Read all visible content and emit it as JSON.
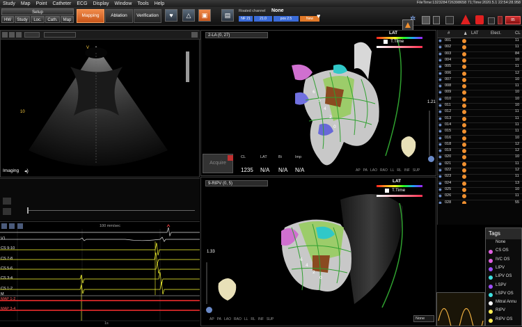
{
  "menu": [
    "Study",
    "Map",
    "Point",
    "Catheter",
    "ECG",
    "Display",
    "Window",
    "Tools",
    "Help"
  ],
  "file_info": "FileTime:1323284726398658 71;Time:2020.5.1 22:54:28.958",
  "toolbar": {
    "setup_label": "Setup",
    "setup_tabs": [
      "HW",
      "Study",
      "Loc.",
      "Cath.",
      "Map"
    ],
    "mapping_label": "Mapping",
    "ablation_label": "Ablation",
    "verification_label": "Verification",
    "roated_channel_label": "Roated channel",
    "roated_channel_value": "None",
    "channel_chips": [
      "NF 21",
      "21.0",
      "pos 2.5",
      "New"
    ]
  },
  "ultrasound": {
    "marker_v": "V",
    "depth_10": "10",
    "imaging_label": "Imaging"
  },
  "ecg": {
    "speed_label": "100 mm/sec",
    "channels": [
      {
        "name": "",
        "color": "#ffffff"
      },
      {
        "name": "V1",
        "color": "#ffffff"
      },
      {
        "name": "CS 9-10",
        "color": "#ffff33"
      },
      {
        "name": "CS 7-8",
        "color": "#ffff33"
      },
      {
        "name": "CS 5-6",
        "color": "#ffff33"
      },
      {
        "name": "CS 3-4",
        "color": "#ffff33"
      },
      {
        "name": "CS 1-2",
        "color": "#ffff33"
      },
      {
        "name": "M",
        "color": "#ffffff"
      },
      {
        "name": "MAP 1-2",
        "color": "#ff3030"
      },
      {
        "name": "MAP 3-4",
        "color": "#ff3030"
      }
    ],
    "time_tick": "1s"
  },
  "map_top": {
    "title": "2-LA (0, 27)",
    "legend_lat": "LAT",
    "legend_ttime": "T.Time",
    "zoom": "1.21",
    "acquire_label": "Acquire",
    "readout_headers": [
      "CL",
      "LAT",
      "Bi",
      "Imp"
    ],
    "readout_values": [
      "1235",
      "N/A",
      "N/A",
      "N/A"
    ],
    "view_buttons": [
      "AP",
      "PA",
      "LAO",
      "RAO",
      "LL",
      "RL",
      "INF",
      "SUP"
    ]
  },
  "map_bottom": {
    "title": "9-RIPV (0, 5)",
    "legend_lat": "LAT",
    "legend_ttime": "T.Time",
    "zoom": "1.33",
    "view_buttons": [
      "AP",
      "PA",
      "LAO",
      "RAO",
      "LL",
      "RL",
      "INF",
      "SUP"
    ],
    "none_select": "None"
  },
  "points_table": {
    "headers": [
      "#",
      "LAT",
      "Elect.",
      "CL"
    ],
    "rows": [
      {
        "id": "001",
        "cl": "11"
      },
      {
        "id": "002",
        "cl": "11"
      },
      {
        "id": "003",
        "cl": "84"
      },
      {
        "id": "004",
        "cl": "10"
      },
      {
        "id": "005",
        "cl": "11"
      },
      {
        "id": "006",
        "cl": "12"
      },
      {
        "id": "007",
        "cl": "10"
      },
      {
        "id": "008",
        "cl": "11"
      },
      {
        "id": "009",
        "cl": "10"
      },
      {
        "id": "010",
        "cl": "10"
      },
      {
        "id": "011",
        "cl": "10"
      },
      {
        "id": "012",
        "cl": "11"
      },
      {
        "id": "013",
        "cl": "11"
      },
      {
        "id": "014",
        "cl": "11"
      },
      {
        "id": "015",
        "cl": "11"
      },
      {
        "id": "016",
        "cl": "10"
      },
      {
        "id": "018",
        "cl": "12"
      },
      {
        "id": "019",
        "cl": "12"
      },
      {
        "id": "020",
        "cl": "10"
      },
      {
        "id": "021",
        "cl": "11"
      },
      {
        "id": "022",
        "cl": "12"
      },
      {
        "id": "023",
        "cl": "11"
      },
      {
        "id": "024",
        "cl": "13"
      },
      {
        "id": "025",
        "cl": "10"
      },
      {
        "id": "026",
        "cl": "11"
      },
      {
        "id": "028",
        "cl": "55"
      }
    ]
  },
  "tags": {
    "title": "Tags",
    "items": [
      {
        "label": "None",
        "color": ""
      },
      {
        "label": "CS OS",
        "color": "#e060e0"
      },
      {
        "label": "IVC OS",
        "color": "#e060e0"
      },
      {
        "label": "LIPV",
        "color": "#a050ff"
      },
      {
        "label": "LIPV OS",
        "color": "#40e0e0"
      },
      {
        "label": "LSPV",
        "color": "#a050ff"
      },
      {
        "label": "LSPV OS",
        "color": "#40e0e0"
      },
      {
        "label": "Mitral Annu",
        "color": "#ffffff"
      },
      {
        "label": "RIPV",
        "color": "#ffee55"
      },
      {
        "label": "RIPV OS",
        "color": "#ffee55"
      }
    ]
  },
  "status": {
    "temp_label": "85"
  }
}
